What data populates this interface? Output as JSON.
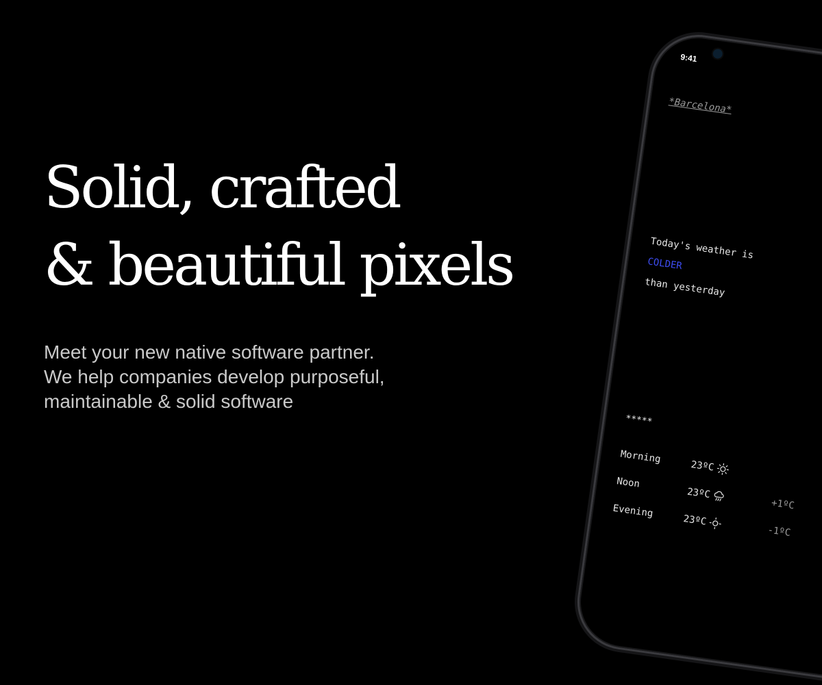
{
  "hero": {
    "headline_line1": "Solid, crafted",
    "headline_line2": "& beautiful pixels",
    "subtitle_line1": "Meet your new native software partner.",
    "subtitle_line2": "We help companies develop purposeful,",
    "subtitle_line3": "maintainable & solid software"
  },
  "phone": {
    "status_time": "9:41",
    "app": {
      "city": "*Barcelona*",
      "line1": "Today's weather is",
      "comparison": "COLDER",
      "line3": "than yesterday",
      "stars": "*****",
      "forecast": [
        {
          "period": "Morning",
          "temp": "23ºC",
          "icon": "sun-icon",
          "delta": ""
        },
        {
          "period": "Noon",
          "temp": "23ºC",
          "icon": "rain-cloud-icon",
          "delta": "+1ºC"
        },
        {
          "period": "Evening",
          "temp": "23ºC",
          "icon": "sun-icon",
          "delta": "-1ºC"
        }
      ]
    }
  },
  "colors": {
    "background": "#000000",
    "headline": "#ffffff",
    "subtitle": "#c9c9c9",
    "accent_colder": "#3d4cf0"
  }
}
